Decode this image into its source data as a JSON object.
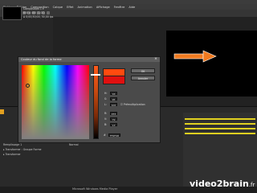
{
  "menubar": {
    "items": [
      "Fichier",
      "Édition",
      "Composition",
      "Calque",
      "Effet",
      "Animation",
      "Affichage",
      "Fenêtre",
      "Aide"
    ]
  },
  "project": {
    "comp_name": "Composition 1 ▾",
    "comp_size": "600 x 400 (1,00)",
    "comp_duration": "Δ 0;00;30;00, 30,00 ips"
  },
  "layers": {
    "text_layer": "Remplissage 1",
    "mode": "Normal",
    "group": "▸ Transformer : Groupe Forme",
    "transform": "▸ Transformer"
  },
  "dialog": {
    "title": "Couleur du fond de la forme",
    "close": "×",
    "ok_label": "OK",
    "cancel_label": "Annuler",
    "fields": [
      {
        "label": "H:",
        "value": "16"
      },
      {
        "label": "S:",
        "value": "95"
      },
      {
        "label": "L:",
        "value": "100"
      },
      {
        "label": "R:",
        "value": "255"
      },
      {
        "label": "V:",
        "value": "79"
      },
      {
        "label": "B:",
        "value": "13"
      }
    ],
    "premultiply_label": "Prémultiplication",
    "hex_label": "#",
    "hex_value": "FF4F0D",
    "colors": {
      "new": "#ff4a0f",
      "old": "#e01010"
    }
  },
  "status": {
    "text": "Microsoft Windows Media Player"
  },
  "brand": {
    "name": "video2brain",
    "suffix": ".fr"
  }
}
